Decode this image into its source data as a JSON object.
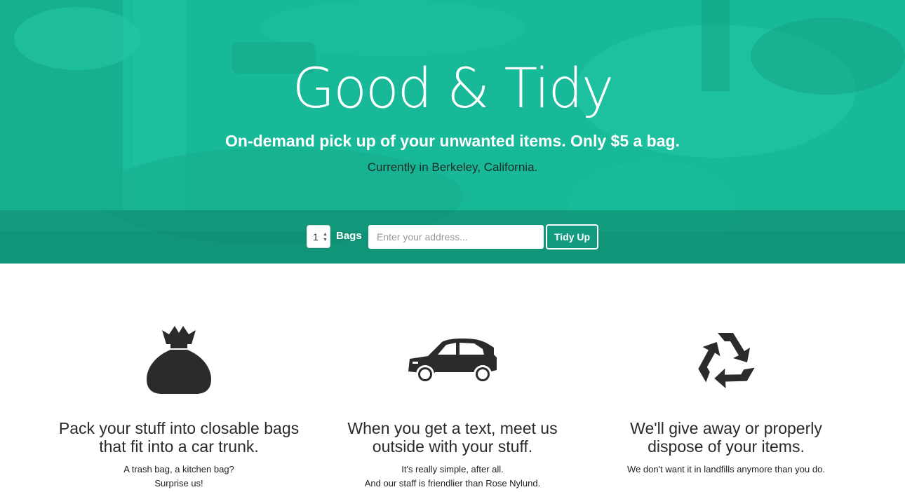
{
  "hero": {
    "title": "Good & Tidy",
    "subtitle": "On-demand pick up of your unwanted items. Only $5 a bag.",
    "location": "Currently in Berkeley, California."
  },
  "order_form": {
    "quantity": "1",
    "bags_label": "Bags",
    "address_placeholder": "Enter your address...",
    "submit_label": "Tidy Up"
  },
  "features": [
    {
      "icon": "money-bag-icon",
      "heading_line1": "Pack your stuff into closable bags",
      "heading_line2": "that fit into a car trunk.",
      "text_line1": "A trash bag, a kitchen bag?",
      "text_line2": "Surprise us!"
    },
    {
      "icon": "car-icon",
      "heading_line1": "When you get a text, meet us",
      "heading_line2": "outside with your stuff.",
      "text_line1": "It's really simple, after all.",
      "text_line2": "And our staff is friendlier than Rose Nylund."
    },
    {
      "icon": "recycle-icon",
      "heading_line1": "We'll give away or properly",
      "heading_line2": "dispose of your items.",
      "text_line1": "We don't want it in landfills anymore than you do."
    }
  ],
  "colors": {
    "brand_green": "#18b998",
    "dark_green_band": "#0c7d63",
    "icon_dark": "#2b2b2d"
  }
}
